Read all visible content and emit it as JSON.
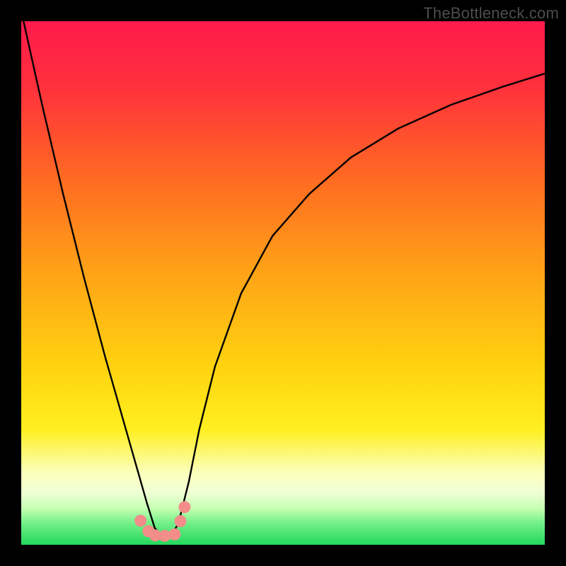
{
  "watermark": "TheBottleneck.com",
  "colors": {
    "top": "#ff1a4b",
    "orange": "#ff7a1f",
    "yellow": "#ffe612",
    "pale": "#fdffc5",
    "green": "#2adc60",
    "curve": "#000000",
    "marker": "#f38d8a",
    "frame": "#000000"
  },
  "chart_data": {
    "type": "line",
    "title": "",
    "xlabel": "",
    "ylabel": "",
    "xlim": [
      0,
      100
    ],
    "ylim": [
      0,
      100
    ],
    "series": [
      {
        "name": "bottleneck-curve",
        "x": [
          0,
          4,
          8,
          12,
          16,
          20,
          22,
          24,
          25.5,
          27,
          28.5,
          30,
          32,
          34,
          37,
          42,
          48,
          55,
          63,
          72,
          82,
          92,
          100
        ],
        "y": [
          102,
          84,
          67,
          51,
          36,
          22,
          15,
          8,
          3.2,
          1.6,
          1.6,
          4,
          12,
          22,
          34,
          48,
          59,
          67,
          74,
          79.5,
          84,
          87.5,
          90
        ]
      },
      {
        "name": "bottom-markers",
        "x": [
          22.8,
          24.3,
          25.6,
          27.4,
          29.3,
          30.4,
          31.2
        ],
        "y": [
          4.6,
          2.6,
          1.8,
          1.7,
          2.0,
          4.5,
          7.2
        ]
      }
    ],
    "annotations": [
      {
        "text": "TheBottleneck.com",
        "position": "top-right"
      }
    ]
  }
}
